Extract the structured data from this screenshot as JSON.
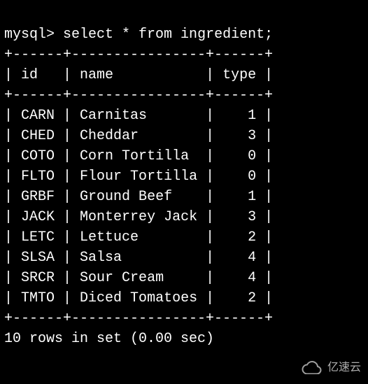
{
  "prompt_prefix": "mysql>",
  "query": "select * from ingredient;",
  "hline": "+------+----------------+------+",
  "header": {
    "id": "id",
    "name": "name",
    "type": "type"
  },
  "rows": [
    {
      "id": "CARN",
      "name": "Carnitas",
      "type": "1"
    },
    {
      "id": "CHED",
      "name": "Cheddar",
      "type": "3"
    },
    {
      "id": "COTO",
      "name": "Corn Tortilla",
      "type": "0"
    },
    {
      "id": "FLTO",
      "name": "Flour Tortilla",
      "type": "0"
    },
    {
      "id": "GRBF",
      "name": "Ground Beef",
      "type": "1"
    },
    {
      "id": "JACK",
      "name": "Monterrey Jack",
      "type": "3"
    },
    {
      "id": "LETC",
      "name": "Lettuce",
      "type": "2"
    },
    {
      "id": "SLSA",
      "name": "Salsa",
      "type": "4"
    },
    {
      "id": "SRCR",
      "name": "Sour Cream",
      "type": "4"
    },
    {
      "id": "TMTO",
      "name": "Diced Tomatoes",
      "type": "2"
    }
  ],
  "footer": "10 rows in set (0.00 sec)",
  "watermark": "亿速云"
}
